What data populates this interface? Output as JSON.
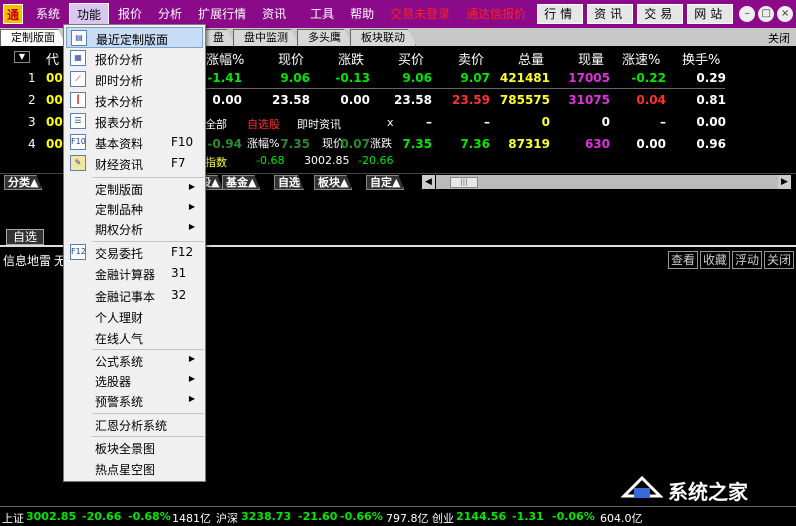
{
  "menubar": {
    "items": [
      "系统",
      "功能",
      "报价",
      "分析",
      "扩展行情",
      "资讯",
      "工具",
      "帮助"
    ],
    "active": "功能",
    "status_notice_1": "交易未登录",
    "status_notice_2": "通达信报价",
    "buttons": [
      "行情",
      "资讯",
      "交易",
      "网站"
    ],
    "window_controls": [
      "–",
      "□",
      "×"
    ]
  },
  "tabs": {
    "items": [
      "定制版面",
      "",
      "盘",
      "盘中监测",
      "多头鹰",
      "板块联动"
    ],
    "close_label": "关闭"
  },
  "quote_table": {
    "sort_button": "▼",
    "headers": {
      "code": "代",
      "change_pct": "涨幅%",
      "price": "现价",
      "change": "涨跌",
      "bid": "买价",
      "ask": "卖价",
      "volume": "总量",
      "cur_volume": "现量",
      "speed": "涨速%",
      "turnover": "换手%"
    },
    "rows": [
      {
        "idx": "1",
        "code": "00",
        "change_pct": "-1.41",
        "price": "9.06",
        "change": "-0.13",
        "bid": "9.06",
        "ask": "9.07",
        "volume": "421481",
        "cur_volume": "17005",
        "speed": "-0.22",
        "turnover": "0.29"
      },
      {
        "idx": "2",
        "code": "00",
        "change_pct": "0.00",
        "price": "23.58",
        "change": "0.00",
        "bid": "23.58",
        "ask": "23.59",
        "volume": "785575",
        "cur_volume": "31075",
        "speed": "0.04",
        "turnover": "0.81"
      },
      {
        "idx": "3",
        "code": "00",
        "change_pct": "",
        "price": "",
        "change": "",
        "bid": "–",
        "ask": "–",
        "volume": "0",
        "cur_volume": "0",
        "speed": "–",
        "turnover": "0.00"
      },
      {
        "idx": "4",
        "code": "00",
        "change_pct": "-0.94",
        "price": "7.35",
        "change": "0.07",
        "bid": "7.35",
        "ask": "7.36",
        "volume": "87319",
        "cur_volume": "630",
        "speed": "0.00",
        "turnover": "0.96"
      }
    ],
    "overlay": {
      "tab_all": "全部",
      "tab_custom": "自选股",
      "tab_news": "即时资讯",
      "close_x": "x",
      "dash": "–",
      "header_change_pct": "涨幅%",
      "header_price": "现价",
      "header_change": "涨跌",
      "index_label": "指数",
      "index_change_pct": "-0.68",
      "index_price": "3002.85",
      "index_change": "-20.66"
    }
  },
  "catbar": {
    "items": [
      "分类▲",
      "股▲",
      "基金▲",
      "自选",
      "板块▲",
      "自定▲"
    ],
    "scroll_left": "◀",
    "scroll_right": "▶",
    "thumb": "|||"
  },
  "midtab": {
    "label": "自选"
  },
  "infobar": {
    "title": "信息地雷",
    "title_suffix": "无",
    "buttons": [
      "查看",
      "收藏",
      "浮动",
      "关闭"
    ]
  },
  "statusbar": {
    "sh_label": "上证",
    "sh_price": "3002.85",
    "sh_change": "-20.66",
    "sh_pct": "-0.68%",
    "sh_amount": "1481亿",
    "sz_label": "沪深",
    "sz_price": "3238.73",
    "sz_change": "-21.60",
    "sz_pct": "-0.66%",
    "sz_amount": "797.8亿",
    "cy_label": "创业",
    "cy_price": "2144.56",
    "cy_change": "-1.31",
    "cy_pct": "-0.06%",
    "cy_amount": "604.0亿"
  },
  "dropdown": {
    "items": [
      {
        "label": "最近定制版面",
        "shortcut": "",
        "icon": "layout-icon",
        "submenu": false
      },
      {
        "label": "报价分析",
        "shortcut": "",
        "icon": "table-icon",
        "submenu": false
      },
      {
        "label": "即时分析",
        "shortcut": "",
        "icon": "line-chart-icon",
        "submenu": false
      },
      {
        "label": "技术分析",
        "shortcut": "",
        "icon": "candlestick-icon",
        "submenu": false
      },
      {
        "label": "报表分析",
        "shortcut": "",
        "icon": "report-icon",
        "submenu": false
      },
      {
        "label": "基本资料",
        "shortcut": "F10",
        "icon": "f10-icon",
        "submenu": false
      },
      {
        "label": "财经资讯",
        "shortcut": "F7",
        "icon": "news-icon",
        "submenu": false
      },
      {
        "label": "定制版面",
        "shortcut": "",
        "icon": "",
        "submenu": true
      },
      {
        "label": "定制品种",
        "shortcut": "",
        "icon": "",
        "submenu": true
      },
      {
        "label": "期权分析",
        "shortcut": "",
        "icon": "",
        "submenu": true
      },
      {
        "label": "交易委托",
        "shortcut": "F12",
        "icon": "f12-icon",
        "submenu": false
      },
      {
        "label": "金融计算器",
        "shortcut": "31",
        "icon": "",
        "submenu": false
      },
      {
        "label": "金融记事本",
        "shortcut": "32",
        "icon": "",
        "submenu": false
      },
      {
        "label": "个人理财",
        "shortcut": "",
        "icon": "",
        "submenu": false
      },
      {
        "label": "在线人气",
        "shortcut": "",
        "icon": "",
        "submenu": false
      },
      {
        "label": "公式系统",
        "shortcut": "",
        "icon": "",
        "submenu": true
      },
      {
        "label": "选股器",
        "shortcut": "",
        "icon": "",
        "submenu": true
      },
      {
        "label": "预警系统",
        "shortcut": "",
        "icon": "",
        "submenu": true
      },
      {
        "label": "汇恩分析系统",
        "shortcut": "",
        "icon": "",
        "submenu": false
      },
      {
        "label": "板块全景图",
        "shortcut": "",
        "icon": "",
        "submenu": false
      },
      {
        "label": "热点星空图",
        "shortcut": "",
        "icon": "",
        "submenu": false
      }
    ]
  },
  "icons": {
    "app": "app-logo-icon",
    "menu_arrow": "▶"
  },
  "watermark": {
    "text": "系统之家"
  },
  "colors": {
    "menubar_bg": "#8a0a8a",
    "up": "#ff3030",
    "down": "#00e800",
    "code": "#ffff00",
    "volume": "#ffff30",
    "cur_volume": "#e030e0"
  }
}
